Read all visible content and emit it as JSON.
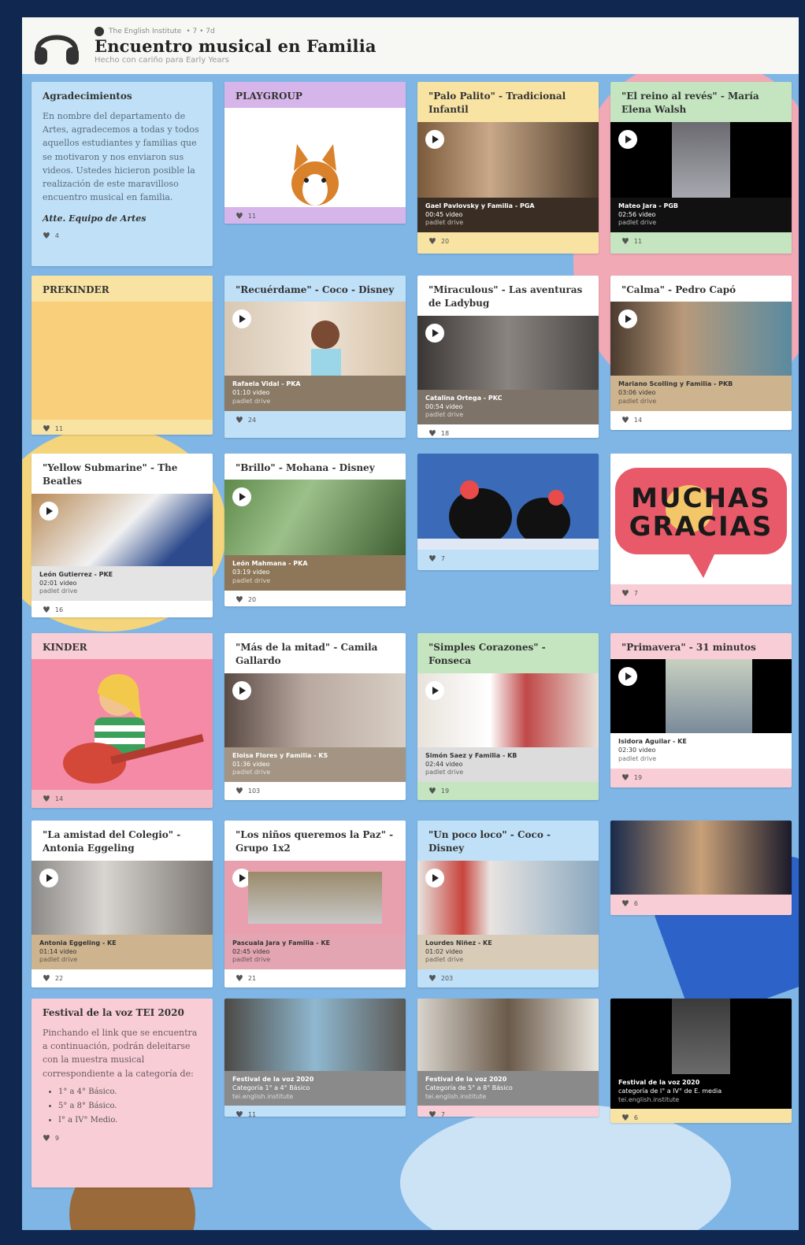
{
  "header": {
    "owner": "The English Institute",
    "meta": "• 7 • 7d",
    "title": "Encuentro musical en Familia",
    "subtitle": "Hecho con cariño para Early Years"
  },
  "cards": {
    "agradecimientos": {
      "title": "Agradecimientos",
      "body": "En nombre del departamento de Artes, agradecemos a todas y todos aquellos estudiantes y familias que se motivaron y nos enviaron sus videos. Ustedes hicieron posible la realización de este maravilloso encuentro musical en familia.",
      "sign": "Atte. Equipo de Artes",
      "likes": "4"
    },
    "playgroup": {
      "title": "PLAYGROUP",
      "likes": "11"
    },
    "palo_palito": {
      "title": "\"Palo Palito\" - Tradicional Infantil",
      "cap1": "Gael Pavlovsky y Familia - PGA",
      "cap2": "00:45 video",
      "cap3": "padlet drive",
      "likes": "20"
    },
    "reino_reves": {
      "title": "\"El reino al revés\" - María Elena Walsh",
      "cap1": "Mateo Jara - PGB",
      "cap2": "02:56 video",
      "cap3": "padlet drive",
      "likes": "11"
    },
    "prekinder": {
      "title": "PREKINDER",
      "likes": "11"
    },
    "recuerdame": {
      "title": "\"Recuérdame\" - Coco - Disney",
      "cap1": "Rafaela Vidal - PKA",
      "cap2": "01:10 video",
      "cap3": "padlet drive",
      "likes": "24"
    },
    "miraculous": {
      "title": "\"Miraculous\" - Las aventuras de Ladybug",
      "cap1": "Catalina Ortega - PKC",
      "cap2": "00:54 video",
      "cap3": "padlet drive",
      "likes": "18"
    },
    "calma": {
      "title": "\"Calma\" - Pedro Capó",
      "cap1": "Mariano Scolling y Familia - PKB",
      "cap2": "03:06 video",
      "cap3": "padlet drive",
      "likes": "14"
    },
    "yellow_sub": {
      "title": "\"Yellow Submarine\" - The Beatles",
      "cap1": "León Gutierrez - PKE",
      "cap2": "02:01 video",
      "cap3": "padlet drive",
      "likes": "16"
    },
    "brillo": {
      "title": "\"Brillo\" - Mohana - Disney",
      "cap1": "León Mahmana - PKA",
      "cap2": "03:19 video",
      "cap3": "padlet drive",
      "likes": "20"
    },
    "cartoon": {
      "likes": "7"
    },
    "gracias": {
      "line1": "MUCHAS",
      "line2": "GRACIAS",
      "likes": "7"
    },
    "kinder": {
      "title": "KINDER",
      "likes": "14"
    },
    "mitad": {
      "title": "\"Más de la mitad\" - Camila Gallardo",
      "cap1": "Eloisa Flores y Familia - KS",
      "cap2": "01:36 video",
      "cap3": "padlet drive",
      "likes": "103"
    },
    "corazones": {
      "title": "\"Simples Corazones\" - Fonseca",
      "cap1": "Simón Saez y Familia - KB",
      "cap2": "02:44 video",
      "cap3": "padlet drive",
      "likes": "19"
    },
    "primavera": {
      "title": "\"Primavera\" - 31 minutos",
      "cap1": "Isidora Aguilar - KE",
      "cap2": "02:30 video",
      "cap3": "padlet drive",
      "likes": "19"
    },
    "amistad": {
      "title": "\"La amistad del Colegio\" - Antonia Eggeling",
      "cap1": "Antonia Eggeling - KE",
      "cap2": "01:14 video",
      "cap3": "padlet drive",
      "likes": "22"
    },
    "paz": {
      "title": "\"Los niños queremos la Paz\" - Grupo 1x2",
      "cap1": "Pascuala Jara y Familia - KE",
      "cap2": "02:45 video",
      "cap3": "padlet drive",
      "likes": "21"
    },
    "poco_loco": {
      "title": "\"Un poco loco\" - Coco - Disney",
      "cap1": "Lourdes Niñez - KE",
      "cap2": "01:02 video",
      "cap3": "padlet drive",
      "likes": "203"
    },
    "applause": {
      "likes": "6"
    },
    "festival": {
      "title": "Festival de la voz TEI 2020",
      "body": "Pinchando el link que se encuentra a continuación, podrán deleitarse con la muestra musical correspondiente a la categoría de:",
      "bullets": [
        "1° a 4° Básico.",
        "5° a 8° Básico.",
        "I° a IV° Medio."
      ],
      "likes": "9"
    },
    "fest1": {
      "cap1": "Festival de la voz 2020",
      "cap2": "Categoría 1° a 4° Básico",
      "cap3": "tei.english.institute",
      "likes": "11"
    },
    "fest2": {
      "cap1": "Festival de la voz 2020",
      "cap2": "Categoría de 5° a 8° Básico",
      "cap3": "tei.english.institute",
      "likes": "7"
    },
    "fest3": {
      "cap1": "Festival de la voz 2020",
      "cap2": "categoría de I° a IV° de E. media",
      "cap3": "tei.english.institute",
      "likes": "6"
    }
  },
  "colors": {
    "frame": "#10284f",
    "wall": "#7fb6e6",
    "blue": "#bfe0f7",
    "purple": "#d6b6ea",
    "yellow": "#f8e3a2",
    "green": "#c4e5c0",
    "pink": "#f4b8c4",
    "gracias_bubble": "#e85a6a"
  }
}
